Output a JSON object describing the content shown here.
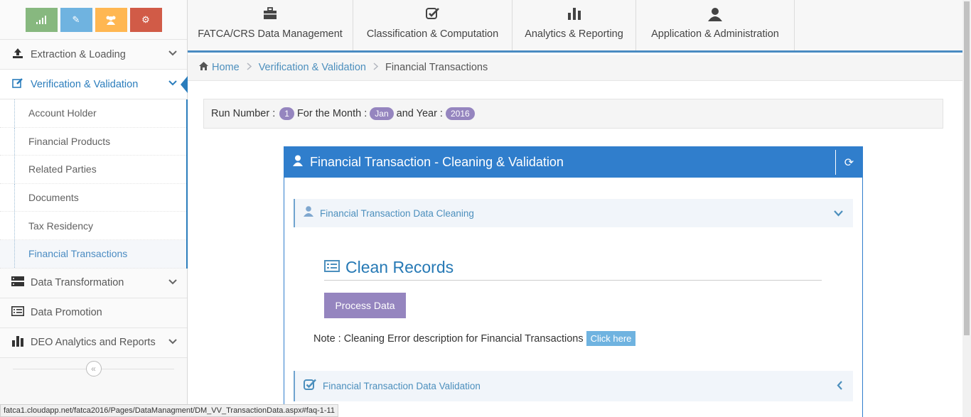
{
  "sidebar": {
    "shortcuts": [
      {
        "icon": "signal-icon",
        "color": "#87b87f"
      },
      {
        "icon": "pencil-icon",
        "color": "#6fb3e0"
      },
      {
        "icon": "users-icon",
        "color": "#ffb752"
      },
      {
        "icon": "cogs-icon",
        "color": "#d15b47"
      }
    ],
    "items": [
      {
        "label": "Extraction & Loading",
        "icon": "upload-icon"
      },
      {
        "label": "Verification & Validation",
        "icon": "edit-icon",
        "active": true
      },
      {
        "label": "Data Transformation",
        "icon": "server-icon"
      },
      {
        "label": "Data Promotion",
        "icon": "list-alt-icon"
      },
      {
        "label": "DEO Analytics and Reports",
        "icon": "bar-chart-icon"
      }
    ],
    "submenu": [
      "Account Holder",
      "Financial Products",
      "Related Parties",
      "Documents",
      "Tax Residency",
      "Financial Transactions"
    ]
  },
  "topnav": [
    {
      "label": "FATCA/CRS Data Management",
      "icon": "briefcase-icon"
    },
    {
      "label": "Classification & Computation",
      "icon": "check-square-icon"
    },
    {
      "label": "Analytics & Reporting",
      "icon": "bar-chart-icon"
    },
    {
      "label": "Application & Administration",
      "icon": "user-icon"
    }
  ],
  "breadcrumb": {
    "home": "Home",
    "section": "Verification & Validation",
    "current": "Financial Transactions"
  },
  "runinfo": {
    "run_label": "Run Number :",
    "run_value": "1",
    "month_label": "For the Month :",
    "month_value": "Jan",
    "year_label": "and Year :",
    "year_value": "2016"
  },
  "widget": {
    "title": "Financial Transaction - Cleaning & Validation",
    "cleaning_title": "Financial Transaction Data Cleaning",
    "section_title": "Clean Records",
    "process_button": "Process Data",
    "note_text": "Note : Cleaning Error description for Financial Transactions",
    "click_here": "Click here",
    "validation_title": "Financial Transaction Data Validation"
  },
  "statusbar": {
    "url": "fatca1.cloudapp.net/fatca2016/Pages/DataManagment/DM_VV_TransactionData.aspx#faq-1-11"
  },
  "colors": {
    "primary": "#307ecc",
    "link": "#4c8fbd",
    "purple": "#9585bf"
  }
}
